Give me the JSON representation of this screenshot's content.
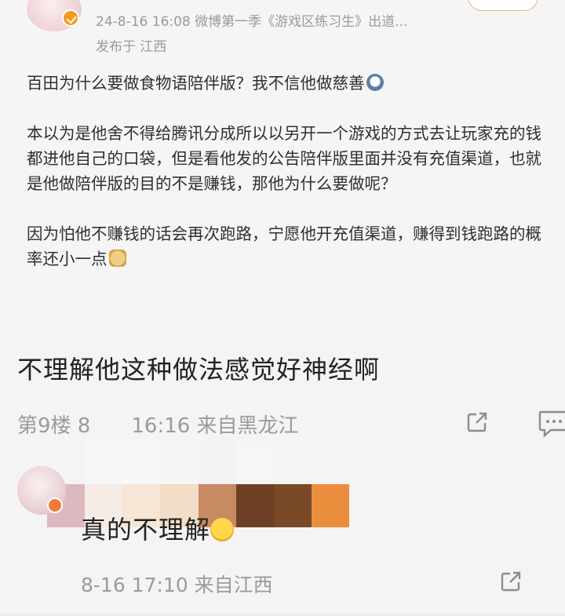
{
  "post": {
    "meta": "24-8-16 16:08  微博第一季《游戏区练习生》出道...",
    "location": "发布于 江西",
    "paragraphs": [
      "百田为什么要做食物语陪伴版？我不信他做慈善",
      "本以为是他舍不得给腾讯分成所以以另开一个游戏的方式去让玩家充的钱都进他自己的口袋，但是看他发的公告陪伴版里面并没有充值渠道，也就是他做陪伴版的目的不是赚钱，那他为什么要做呢？",
      "因为怕他不赚钱的话会再次跑路，宁愿他开充值渠道，赚得到钱跑路的概率还小一点"
    ],
    "emoji_1": "shock-face-emoji",
    "emoji_3": "doge-emoji"
  },
  "comment": {
    "question": "不理解他这种做法感觉好神经啊",
    "floor": "第9楼  8",
    "floor_rest": "16:16  来自黑龙江",
    "reply_text": "真的不理解",
    "reply_meta": "8-16 17:10  来自江西"
  },
  "colors": {
    "censor_row1": [
      "#f4f4f4",
      "#f7f7f7",
      "#f8f8f8",
      "#f5f5f5",
      "#f2f2f2",
      "#f6f6f6",
      "#f4f4f4",
      "#f4f4f4"
    ],
    "censor_row2": [
      "#dcb9c0",
      "#f6ece6",
      "#f7e6d6",
      "#f2ddc7",
      "#c88a62",
      "#6e4126",
      "#7a4a28",
      "#ea8e3d"
    ]
  }
}
